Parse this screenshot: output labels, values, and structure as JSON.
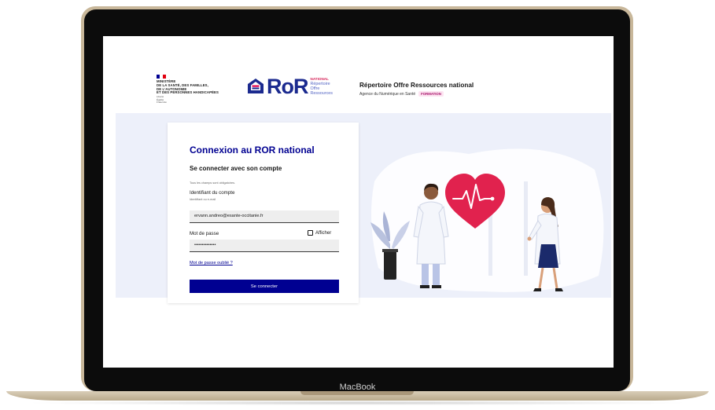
{
  "device": {
    "chin_label": "MacBook"
  },
  "header": {
    "ministry_lines": [
      "MINISTÈRE",
      "DE LA SANTÉ, DES FAMILLES,",
      "DE L'AUTONOMIE",
      "ET DES PERSONNES HANDICAPÉES"
    ],
    "devise_lines": [
      "Liberté",
      "Égalité",
      "Fraternité"
    ],
    "ror_word": "RoR",
    "ror_national": "NATIONAL",
    "ror_sub_lines": [
      "Répertoire",
      "Offre",
      "Ressources"
    ],
    "app_title": "Répertoire Offre Ressources national",
    "agency": "Agence du Numérique en Santé",
    "badge": "FORMATION"
  },
  "login": {
    "title": "Connexion au ROR national",
    "subtitle": "Se connecter avec son compte",
    "mandatory_note": "Tous les champs sont obligatoires.",
    "identifier_label": "Identifiant du compte",
    "identifier_hint": "Identifiant ou e-mail",
    "identifier_value": "ervann.andreo@esante-occitanie.fr",
    "password_label": "Mot de passe",
    "show_label": "Afficher",
    "password_value": "••••••••••••••",
    "forgot_label": "Mot de passe oublié ?",
    "submit_label": "Se connecter"
  },
  "colors": {
    "primary": "#000091",
    "accent_red": "#e1004b",
    "badge_bg": "#fde4f1",
    "main_bg": "#edf0fa",
    "laptop_gold": "#c8b79a"
  },
  "icons": [
    "laptop-frame",
    "marianne-logo",
    "ror-logo",
    "heart-ecg-illustration",
    "doctors-illustration",
    "plant-illustration"
  ]
}
